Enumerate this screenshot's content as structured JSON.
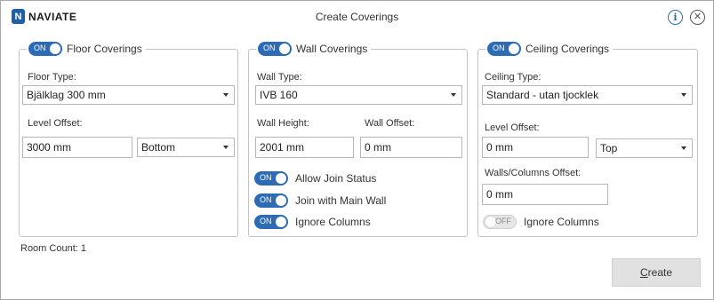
{
  "header": {
    "logo_letter": "N",
    "logo_text": "NAVIATE",
    "title": "Create Coverings",
    "info_glyph": "i",
    "close_glyph": "✕"
  },
  "floor": {
    "toggle": "ON",
    "title": "Floor Coverings",
    "type_label": "Floor Type:",
    "type_value": "Bjälklag 300 mm",
    "offset_label": "Level Offset:",
    "offset_value": "3000 mm",
    "offset_ref": "Bottom"
  },
  "wall": {
    "toggle": "ON",
    "title": "Wall Coverings",
    "type_label": "Wall Type:",
    "type_value": "IVB 160",
    "height_label": "Wall Height:",
    "height_value": "2001 mm",
    "offset_label": "Wall Offset:",
    "offset_value": "0 mm",
    "options": [
      {
        "toggle": "ON",
        "label": "Allow Join Status"
      },
      {
        "toggle": "ON",
        "label": "Join with Main Wall"
      },
      {
        "toggle": "ON",
        "label": "Ignore Columns"
      }
    ]
  },
  "ceiling": {
    "toggle": "ON",
    "title": "Ceiling Coverings",
    "type_label": "Ceiling Type:",
    "type_value": "Standard - utan tjocklek",
    "offset_label": "Level Offset:",
    "offset_value": "0 mm",
    "offset_ref": "Top",
    "walls_offset_label": "Walls/Columns Offset:",
    "walls_offset_value": "0 mm",
    "ignore_toggle": "OFF",
    "ignore_label": "Ignore Columns"
  },
  "footer": {
    "room_count": "Room Count:  1",
    "create_label": "Create"
  },
  "colors": {
    "accent": "#2d6cb5",
    "toggle_off": "#e6e6e6",
    "button_bg": "#e1e1e1"
  },
  "icons": [
    "naviate-logo",
    "info-icon",
    "close-icon",
    "dropdown-arrow-icon"
  ]
}
